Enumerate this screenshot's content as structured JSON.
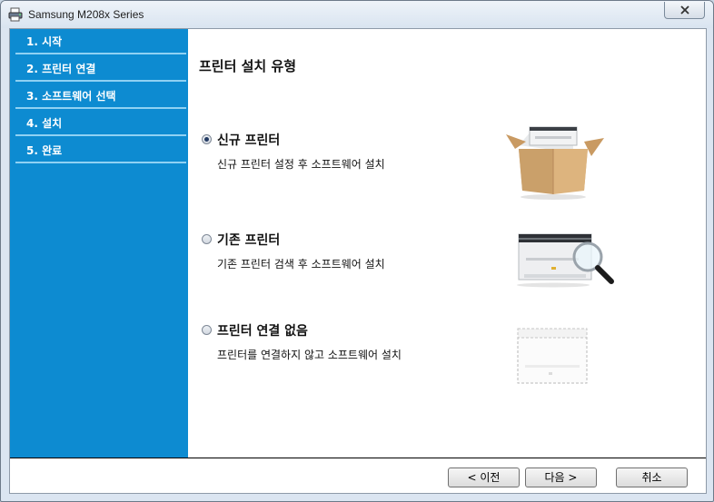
{
  "window": {
    "title": "Samsung M208x Series"
  },
  "sidebar": {
    "steps": [
      {
        "label": "1. 시작"
      },
      {
        "label": "2. 프린터 연결"
      },
      {
        "label": "3. 소프트웨어 선택"
      },
      {
        "label": "4. 설치"
      },
      {
        "label": "5. 완료"
      }
    ]
  },
  "main": {
    "title": "프린터 설치 유형",
    "options": [
      {
        "label": "신규 프린터",
        "desc": "신규 프린터 설정 후 소프트웨어 설치",
        "selected": true
      },
      {
        "label": "기존 프린터",
        "desc": "기존 프린터 검색 후 소프트웨어 설치",
        "selected": false
      },
      {
        "label": "프린터 연결 없음",
        "desc": "프린터를 연결하지 않고 소프트웨어 설치",
        "selected": false
      }
    ]
  },
  "footer": {
    "back_label": "< 이전",
    "next_label": "다음 >",
    "cancel_label": "취소"
  },
  "colors": {
    "sidebar": "#0d8bd1",
    "divider": "#8fd1f3"
  }
}
